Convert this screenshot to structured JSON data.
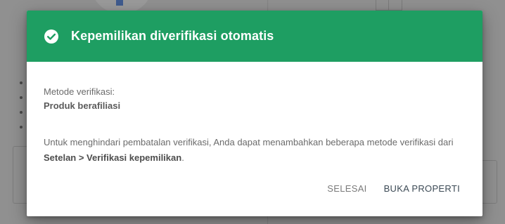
{
  "dialog": {
    "title": "Kepemilikan diverifikasi otomatis",
    "method_label": "Metode verifikasi:",
    "method_value": "Produk berafiliasi",
    "info_prefix": "Untuk menghindari pembatalan verifikasi, Anda dapat menambahkan beberapa metode verifikasi dari ",
    "info_link": "Setelan > Verifikasi kepemilikan",
    "info_suffix": ".",
    "buttons": {
      "done": "SELESAI",
      "open_property": "BUKA PROPERTI"
    },
    "header_color": "#1e9e62",
    "icon": "check-circle-icon"
  }
}
